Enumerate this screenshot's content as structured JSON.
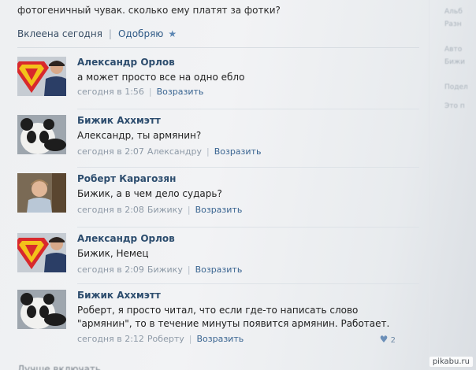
{
  "post": {
    "text": "фотогеничный чувак. сколько ему платят за фотки?",
    "pinned_label": "Вклеена сегодня",
    "like_label": "Одобряю"
  },
  "comments": [
    {
      "author": "Александр Орлов",
      "text": "а может просто все на одно ебло",
      "time": "сегодня в 1:56",
      "reply_to": "",
      "reply_label": "Возразить",
      "avatar": "superman-avatar"
    },
    {
      "author": "Бижик Аххмэтт",
      "text": "Александр, ты армянин?",
      "time": "сегодня в 2:07",
      "reply_to": "Александру",
      "reply_label": "Возразить",
      "avatar": "panda-avatar"
    },
    {
      "author": "Роберт Карагозян",
      "text": "Бижик, а в чем дело сударь?",
      "time": "сегодня в 2:08",
      "reply_to": "Бижику",
      "reply_label": "Возразить",
      "avatar": "child-avatar"
    },
    {
      "author": "Александр Орлов",
      "text": "Бижик, Немец",
      "time": "сегодня в 2:09",
      "reply_to": "Бижику",
      "reply_label": "Возразить",
      "avatar": "superman-avatar"
    },
    {
      "author": "Бижик Аххмэтт",
      "text": "Роберт, я просто читал, что если где-то написать слово \"армянин\", то в течение минуты появится армянин. Работает.",
      "time": "сегодня в 2:12",
      "reply_to": "Роберту",
      "reply_label": "Возразить",
      "avatar": "panda-avatar",
      "likes": "2"
    }
  ],
  "sidebar": [
    "Альб",
    "Разн",
    "Авто",
    "Бижи",
    "Подел",
    "Это п"
  ],
  "bottom": "Лучше включать",
  "watermark": "pikabu.ru",
  "colors": {
    "link": "#2f5a86",
    "name": "#2d4d6e",
    "meta": "#8d99a6"
  }
}
